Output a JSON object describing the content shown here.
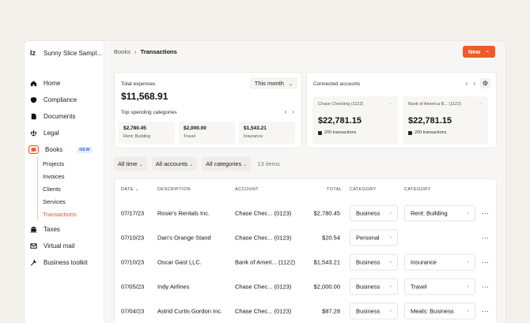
{
  "app": {
    "name": "Sunny Slice Sampl..."
  },
  "sidebar": {
    "items": [
      {
        "label": "Home",
        "icon": "home-icon"
      },
      {
        "label": "Compliance",
        "icon": "shield-icon"
      },
      {
        "label": "Documents",
        "icon": "document-icon"
      },
      {
        "label": "Legal",
        "icon": "scale-icon"
      },
      {
        "label": "Books",
        "icon": "books-icon",
        "badge": "NEW"
      },
      {
        "label": "Taxes",
        "icon": "bank-icon"
      },
      {
        "label": "Virtual mail",
        "icon": "mail-icon"
      },
      {
        "label": "Business toolkit",
        "icon": "wrench-icon"
      }
    ],
    "books_sub": [
      "Projects",
      "Invoices",
      "Clients",
      "Services",
      "Transactions"
    ]
  },
  "breadcrumb": {
    "parent": "Books",
    "sep": "›",
    "current": "Transactions"
  },
  "new_button": {
    "label": "New",
    "chev": "⌄"
  },
  "expenses": {
    "label": "Total expenses",
    "amount": "$11,568.91",
    "period": "This month",
    "period_chev": "⌄",
    "top_label": "Top spending categories",
    "cats": [
      {
        "value": "$2,780.45",
        "name": "Rent: Building"
      },
      {
        "value": "$2,000.00",
        "name": "Travel"
      },
      {
        "value": "$1,543.21",
        "name": "Insurance"
      }
    ]
  },
  "accounts": {
    "label": "Connected accounts",
    "list": [
      {
        "name": "Chase Checking (1122)",
        "balance": "$22,781.15",
        "tx": "200 transactions"
      },
      {
        "name": "Bank of America B...",
        "more": "(1122)",
        "balance": "$22,781.15",
        "tx": "200 transactions"
      }
    ]
  },
  "filters": {
    "time": "All time",
    "accounts": "All accounts",
    "categories": "All categories",
    "count": "13 items",
    "chev": "⌄"
  },
  "table": {
    "headers": {
      "date": "DATE",
      "desc": "DESCRIPTION",
      "account": "ACCOUNT",
      "total": "TOTAL",
      "cat1": "CATEGORY",
      "cat2": "CATEGORY"
    },
    "rows": [
      {
        "date": "07/17/23",
        "desc": "Rosie's Rentals Inc.",
        "account": "Chase Chec... (0123)",
        "total": "$2,780.45",
        "cat1": "Business",
        "cat2": "Rent: Building"
      },
      {
        "date": "07/10/23",
        "desc": "Dan's Orange Stand",
        "account": "Chase Chec... (0123)",
        "total": "$20.54",
        "cat1": "Personal",
        "cat2": ""
      },
      {
        "date": "07/10/23",
        "desc": "Oscar Gast LLC.",
        "account": "Bank of Ameri... (1122)",
        "total": "$1,543.21",
        "cat1": "Business",
        "cat2": "Insurance"
      },
      {
        "date": "07/05/23",
        "desc": "Indy Airlines",
        "account": "Chase Chec... (0123)",
        "total": "$2,000.00",
        "cat1": "Business",
        "cat2": "Travel"
      },
      {
        "date": "07/04/23",
        "desc": "Astrid Curtis Gordon Inc.",
        "account": "Chase Chec... (0123)",
        "total": "$87.28",
        "cat1": "Business",
        "cat2": "Meals: Business"
      }
    ]
  }
}
